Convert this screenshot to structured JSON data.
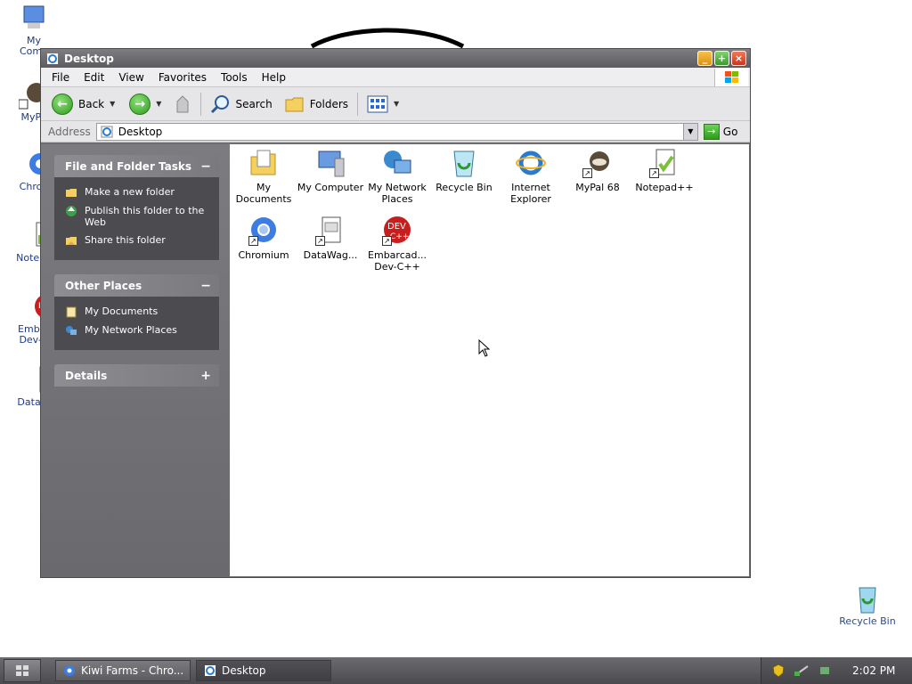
{
  "desktop": {
    "icons": [
      {
        "label": "My Computer",
        "shown": "My\nComp"
      },
      {
        "label": "MyPal",
        "shown": "MyPa"
      },
      {
        "label": "Chromium",
        "shown": "Chron"
      },
      {
        "label": "Notepad++",
        "shown": "Notepa"
      },
      {
        "label": "Embarcadero Dev-C++",
        "shown": "Embar\nDev-C"
      },
      {
        "label": "DataWag",
        "shown": "DataW"
      },
      {
        "label": "Recycle Bin",
        "shown": "Recycle Bin"
      }
    ]
  },
  "window": {
    "title": "Desktop",
    "menu": [
      "File",
      "Edit",
      "View",
      "Favorites",
      "Tools",
      "Help"
    ],
    "toolbar": {
      "back": "Back",
      "search": "Search",
      "folders": "Folders"
    },
    "address": {
      "label": "Address",
      "value": "Desktop",
      "go": "Go"
    },
    "panels": [
      {
        "title": "File and Folder Tasks",
        "toggle": "−",
        "items": [
          "Make a new folder",
          "Publish this folder to the Web",
          "Share this folder"
        ]
      },
      {
        "title": "Other Places",
        "toggle": "−",
        "items": [
          "My Documents",
          "My Network Places"
        ]
      },
      {
        "title": "Details",
        "toggle": "+",
        "items": []
      }
    ],
    "items": [
      {
        "label": "My Documents",
        "icon": "my-documents"
      },
      {
        "label": "My Computer",
        "icon": "my-computer"
      },
      {
        "label": "My Network Places",
        "icon": "network"
      },
      {
        "label": "Recycle Bin",
        "icon": "recycle-bin"
      },
      {
        "label": "Internet Explorer",
        "icon": "ie"
      },
      {
        "label": "MyPal 68",
        "icon": "mypal"
      },
      {
        "label": "Notepad++",
        "icon": "notepad"
      },
      {
        "label": "Chromium",
        "icon": "chromium"
      },
      {
        "label": "DataWag...",
        "icon": "datawag"
      },
      {
        "label": "Embarcad... Dev-C++",
        "icon": "devcpp"
      }
    ]
  },
  "taskbar": {
    "buttons": [
      "Kiwi Farms - Chro...",
      "Desktop"
    ],
    "clock": "2:02 PM"
  },
  "colors": {
    "accent_green": "#2f9a1f",
    "sidebar": "#6a6a6e",
    "panel_body": "#4b4b50"
  }
}
